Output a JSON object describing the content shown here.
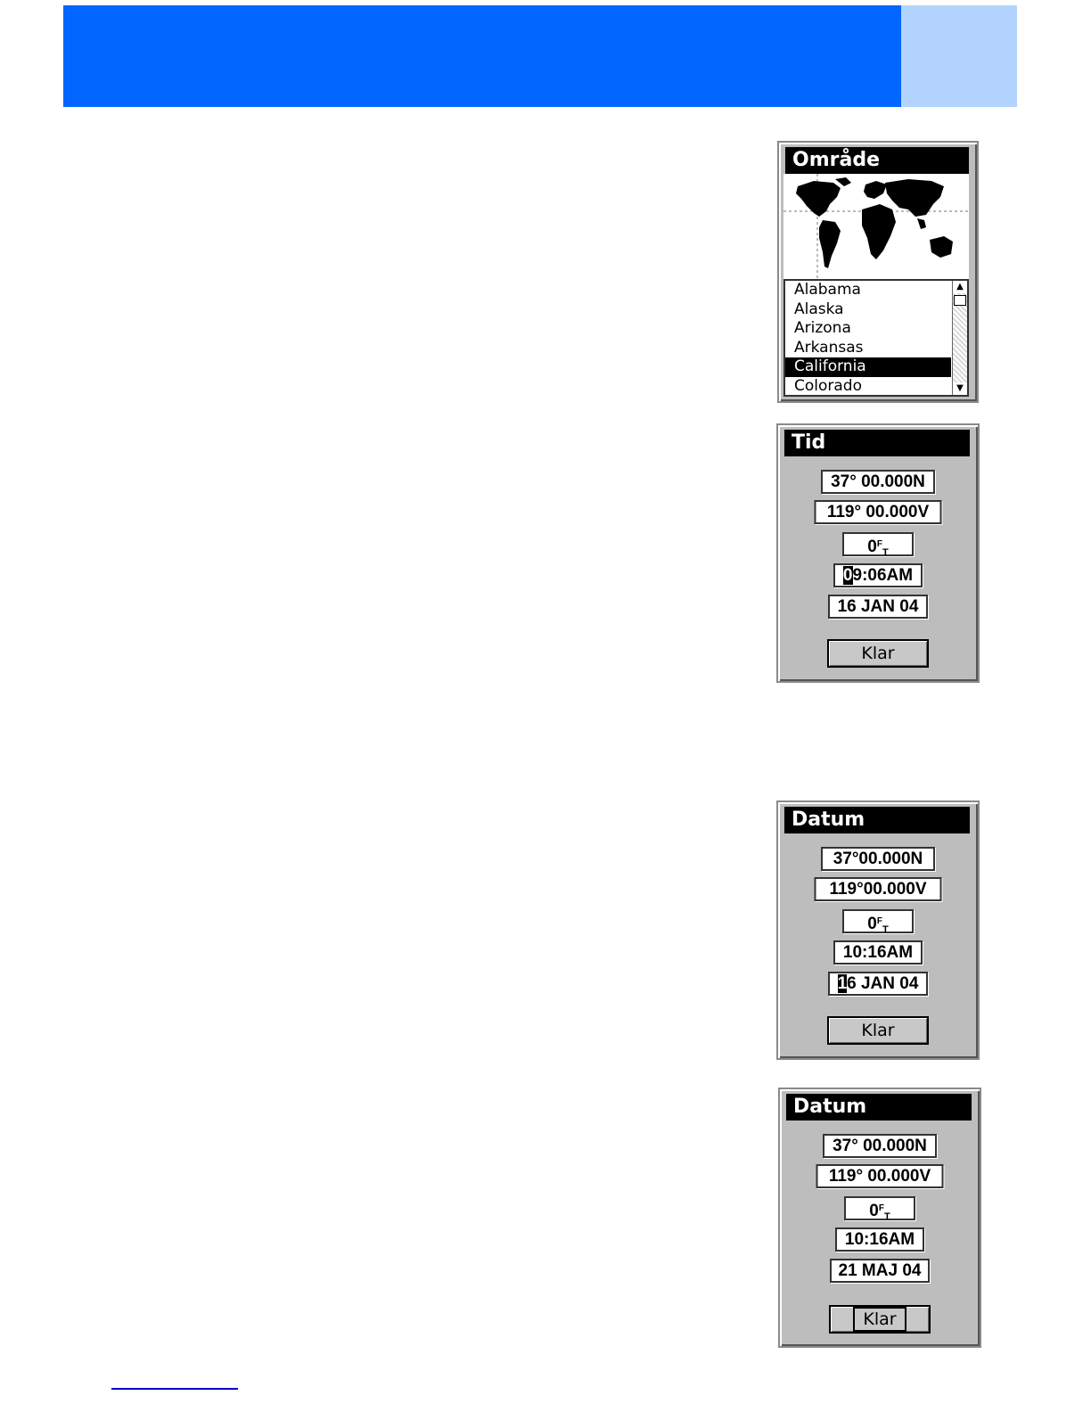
{
  "colors": {
    "header_blue": "#0066ff",
    "header_light": "#b3d4ff",
    "screen_gray": "#bdbdbd"
  },
  "area_screen": {
    "title": "Område",
    "regions": [
      "Alabama",
      "Alaska",
      "Arizona",
      "Arkansas",
      "California",
      "Colorado"
    ],
    "selected_region": "California"
  },
  "time_screen": {
    "title": "Tid",
    "latitude": "37° 00.000N",
    "longitude": "119° 00.000V",
    "altitude_value": "0",
    "altitude_unit_top": "F",
    "altitude_unit_bottom": "T",
    "time_cursor": "0",
    "time_rest": "9:06AM",
    "date": "16 JAN 04",
    "done_label": "Klar"
  },
  "date_screen_1": {
    "title": "Datum",
    "latitude": "37°00.000N",
    "longitude": "119°00.000V",
    "altitude_value": "0",
    "altitude_unit_top": "F",
    "altitude_unit_bottom": "T",
    "time": "10:16AM",
    "date_cursor": "1",
    "date_rest": "6 JAN 04",
    "done_label": "Klar"
  },
  "date_screen_2": {
    "title": "Datum",
    "latitude": "37° 00.000N",
    "longitude": "119° 00.000V",
    "altitude_value": "0",
    "altitude_unit_top": "F",
    "altitude_unit_bottom": "T",
    "time": "10:16AM",
    "date": "21 MAJ 04",
    "done_label": "Klar"
  }
}
